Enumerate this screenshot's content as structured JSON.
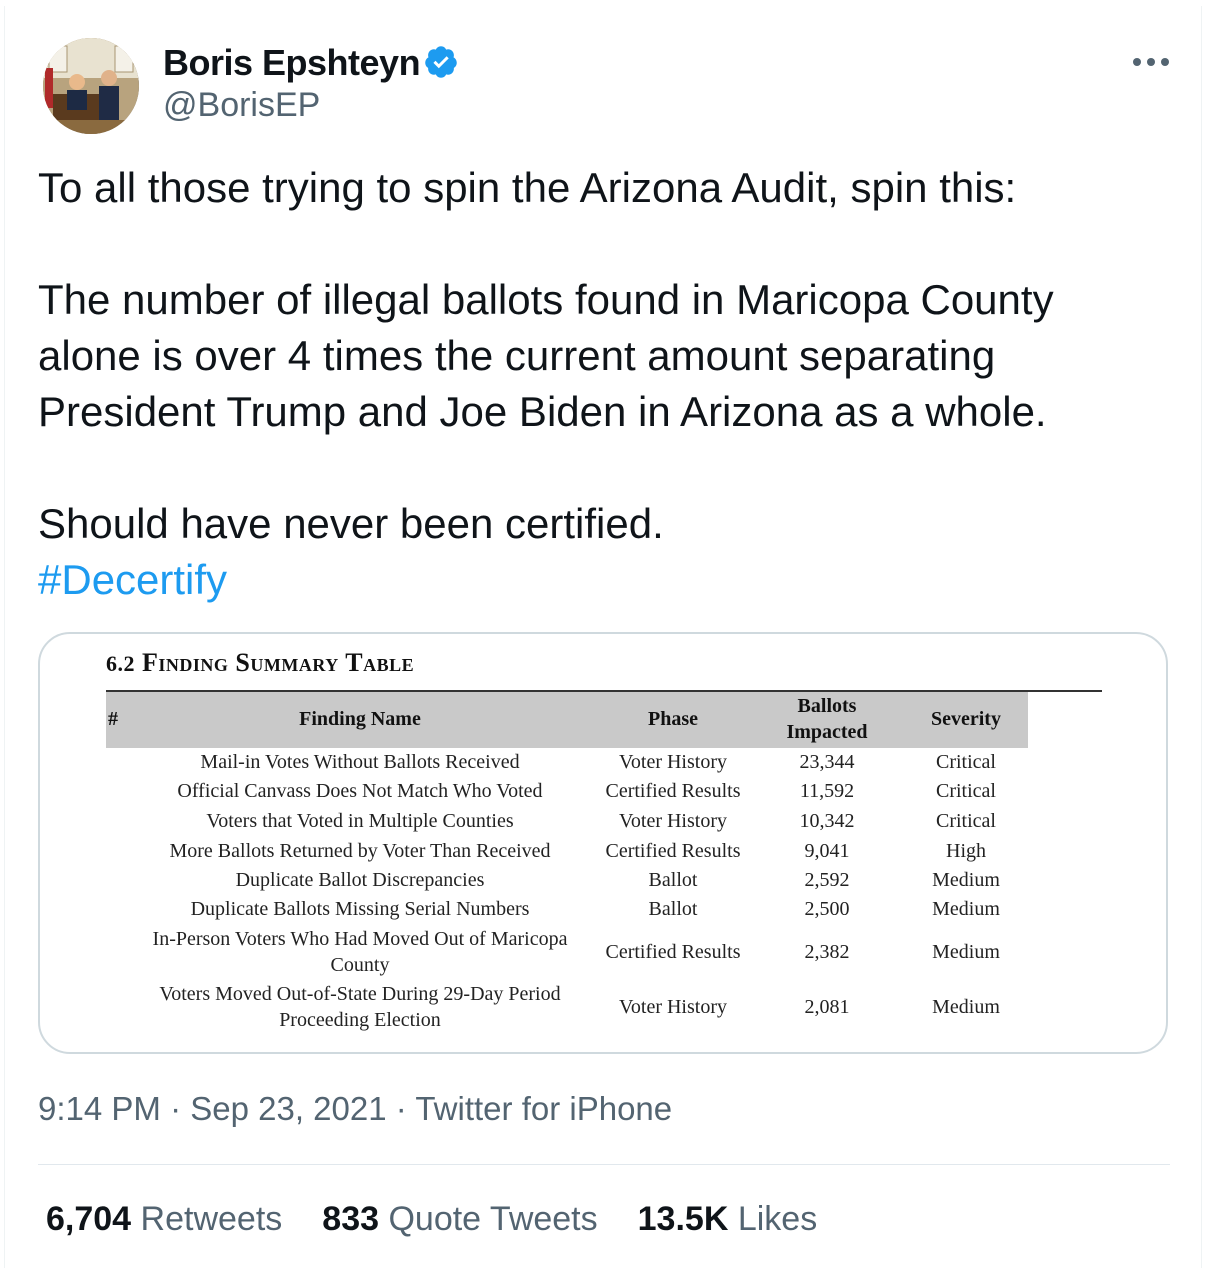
{
  "tweet": {
    "display_name": "Boris Epshteyn",
    "handle": "@BorisEP",
    "text_line1": "To all those trying to spin the Arizona Audit, spin this:",
    "text_para2": "The number of illegal ballots found in Maricopa County\nalone is over 4 times the current amount separating\nPresident Trump and Joe Biden in Arizona as a whole.",
    "text_para3": "Should have never been certified.",
    "hashtag": "#Decertify",
    "time": "9:14 PM",
    "date": "Sep 23, 2021",
    "source": "Twitter for iPhone",
    "sep": "·"
  },
  "stats": {
    "retweets_count": "6,704",
    "retweets_label": "Retweets",
    "quotes_count": "833",
    "quotes_label": "Quote Tweets",
    "likes_count": "13.5K",
    "likes_label": "Likes"
  },
  "colors": {
    "accent": "#1d9bf0",
    "secondary_text": "#536471",
    "verified_badge": "#1d9bf0"
  },
  "icons": {
    "verified": "verified-badge-icon",
    "more": "more-dots-icon"
  },
  "table": {
    "title_num": "6.2",
    "title": "Finding Summary Table",
    "headers": {
      "num": "#",
      "finding": "Finding Name",
      "phase": "Phase",
      "ballots_1": "Ballots",
      "ballots_2": "Impacted",
      "severity": "Severity"
    },
    "rows": [
      {
        "name": "Mail-in Votes Without Ballots Received",
        "phase": "Voter History",
        "ballots": "23,344",
        "severity": "Critical"
      },
      {
        "name": "Official Canvass Does Not Match Who Voted",
        "phase": "Certified Results",
        "ballots": "11,592",
        "severity": "Critical"
      },
      {
        "name": "Voters that Voted in Multiple Counties",
        "phase": "Voter History",
        "ballots": "10,342",
        "severity": "Critical"
      },
      {
        "name": "More Ballots Returned by Voter Than Received",
        "phase": "Certified Results",
        "ballots": "9,041",
        "severity": "High"
      },
      {
        "name": "Duplicate Ballot Discrepancies",
        "phase": "Ballot",
        "ballots": "2,592",
        "severity": "Medium"
      },
      {
        "name": "Duplicate Ballots Missing Serial Numbers",
        "phase": "Ballot",
        "ballots": "2,500",
        "severity": "Medium"
      },
      {
        "name": "In-Person Voters Who Had Moved Out of Maricopa",
        "name2": "County",
        "phase": "Certified Results",
        "ballots": "2,382",
        "severity": "Medium"
      },
      {
        "name": "Voters Moved Out-of-State During 29-Day Period",
        "name2": "Proceeding Election",
        "phase": "Voter History",
        "ballots": "2,081",
        "severity": "Medium"
      }
    ]
  }
}
